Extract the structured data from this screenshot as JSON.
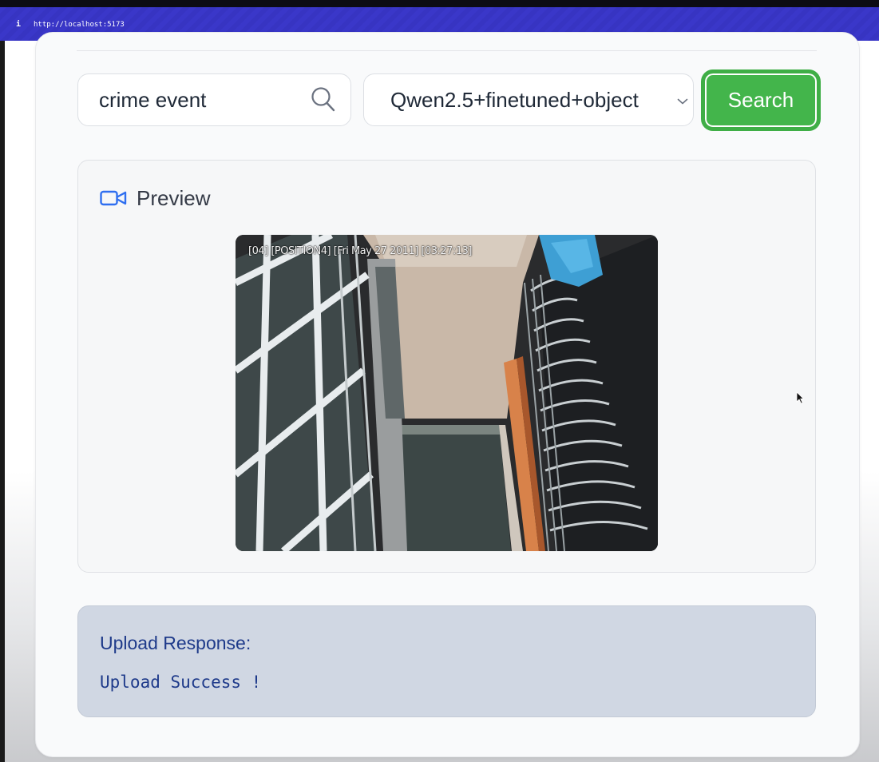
{
  "browser": {
    "info_icon": "i",
    "url": "http://localhost:5173"
  },
  "search": {
    "query": "crime event",
    "icon": "search-icon"
  },
  "model_select": {
    "selected": "Qwen2.5+finetuned+object"
  },
  "search_button": {
    "label": "Search",
    "color": "#43b54b"
  },
  "preview": {
    "title": "Preview",
    "icon": "video-camera-icon",
    "video_overlay": "[04] [POSITION4] [Fri May 27 2011] [03:27:13]"
  },
  "upload_response": {
    "title": "Upload Response:",
    "message": "Upload Success !"
  },
  "colors": {
    "top_bar": "#3a37c9",
    "accent_blue": "#2f6ff0",
    "response_text": "#1e3a8a"
  }
}
